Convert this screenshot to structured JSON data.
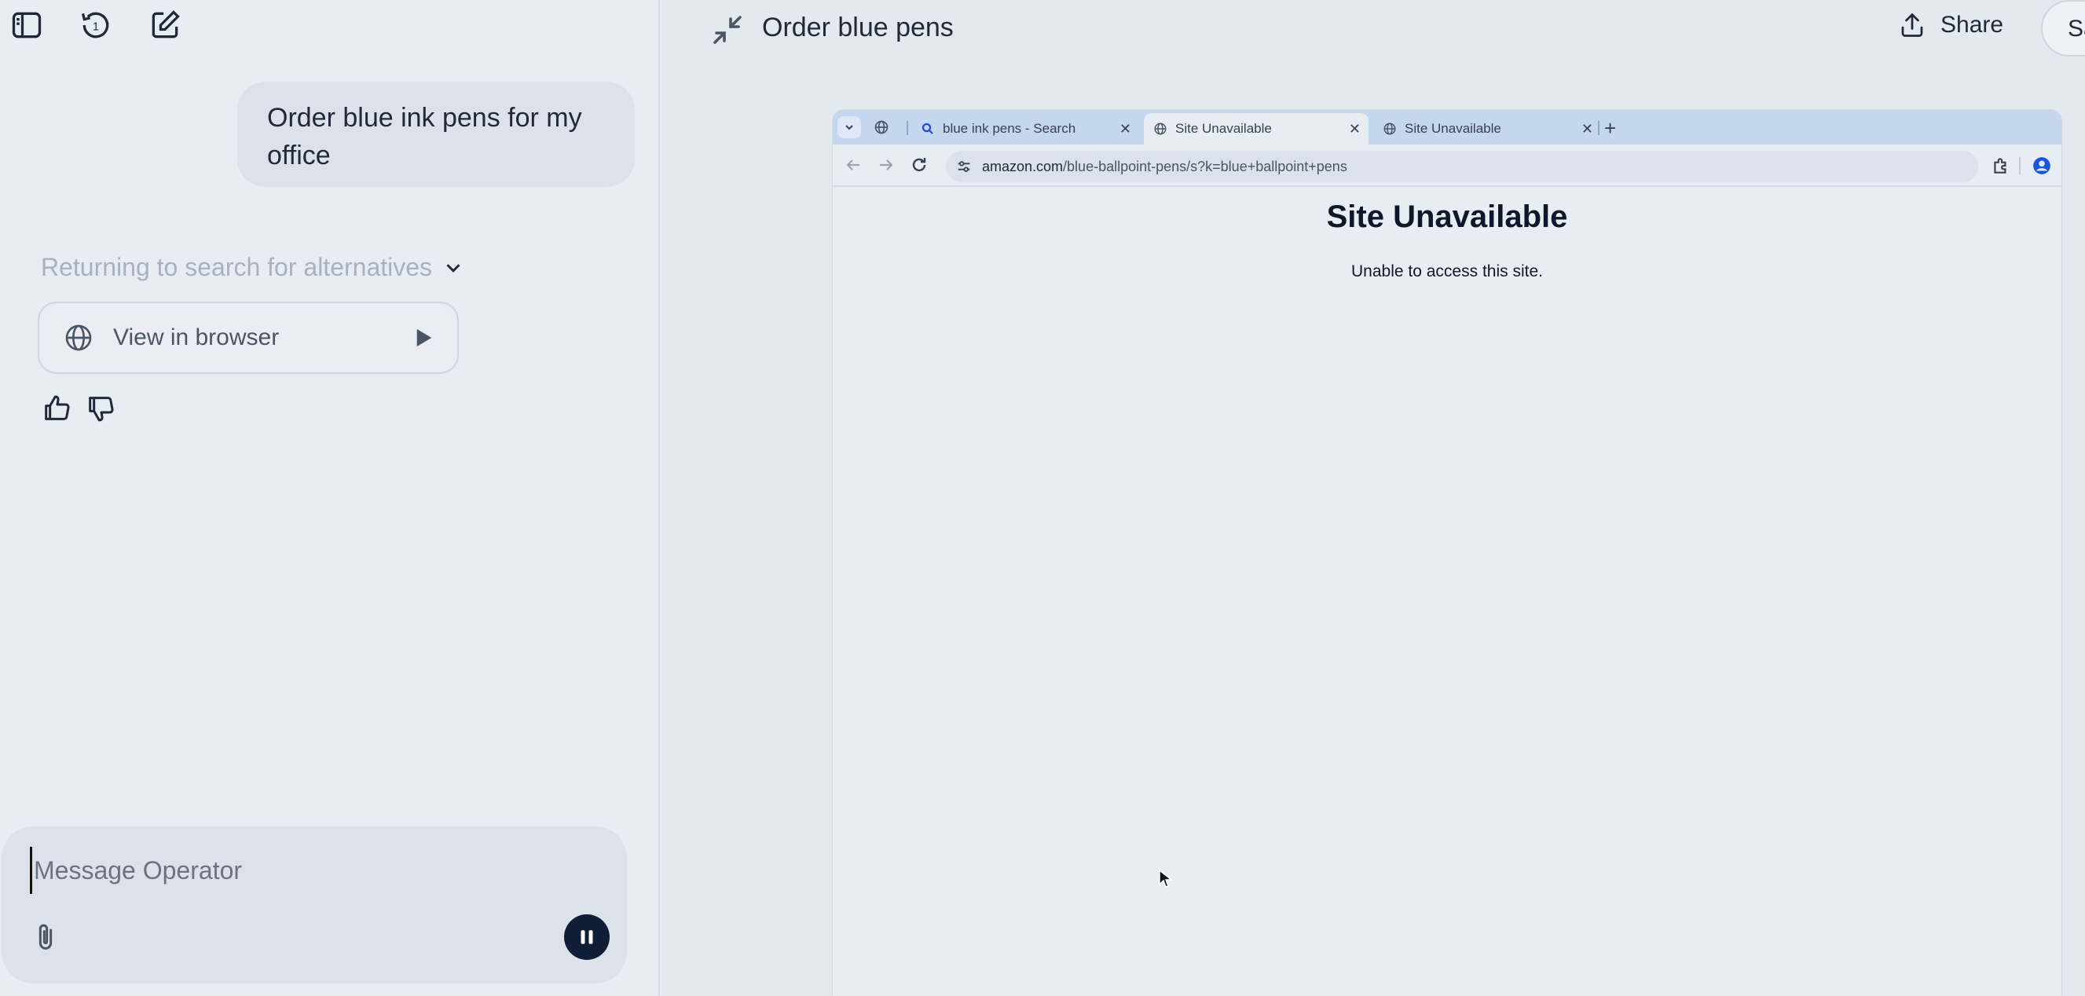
{
  "sidebar_toolbar": {
    "icons": [
      "sidebar-toggle-icon",
      "history-icon",
      "new-chat-icon"
    ],
    "history_count": "1"
  },
  "conversation": {
    "user_message": "Order blue ink pens for my office",
    "status": "Returning to search for alternatives",
    "view_in_browser_label": "View in browser"
  },
  "composer": {
    "placeholder": "Message Operator"
  },
  "header": {
    "task_title": "Order blue pens",
    "share_label": "Share",
    "save_label_partial": "Sa"
  },
  "browser": {
    "tabs": [
      {
        "title": "blue ink pens - Search",
        "active": false
      },
      {
        "title": "Site Unavailable",
        "active": true
      },
      {
        "title": "Site Unavailable",
        "active": false
      }
    ],
    "url_domain": "amazon.com",
    "url_path": "/blue-ballpoint-pens/s?k=blue+ballpoint+pens",
    "page_heading": "Site Unavailable",
    "page_message": "Unable to access this site."
  },
  "colors": {
    "background": "#e8edf4",
    "tabbar": "#c5d6ef",
    "pause_button": "#0f1d36"
  }
}
